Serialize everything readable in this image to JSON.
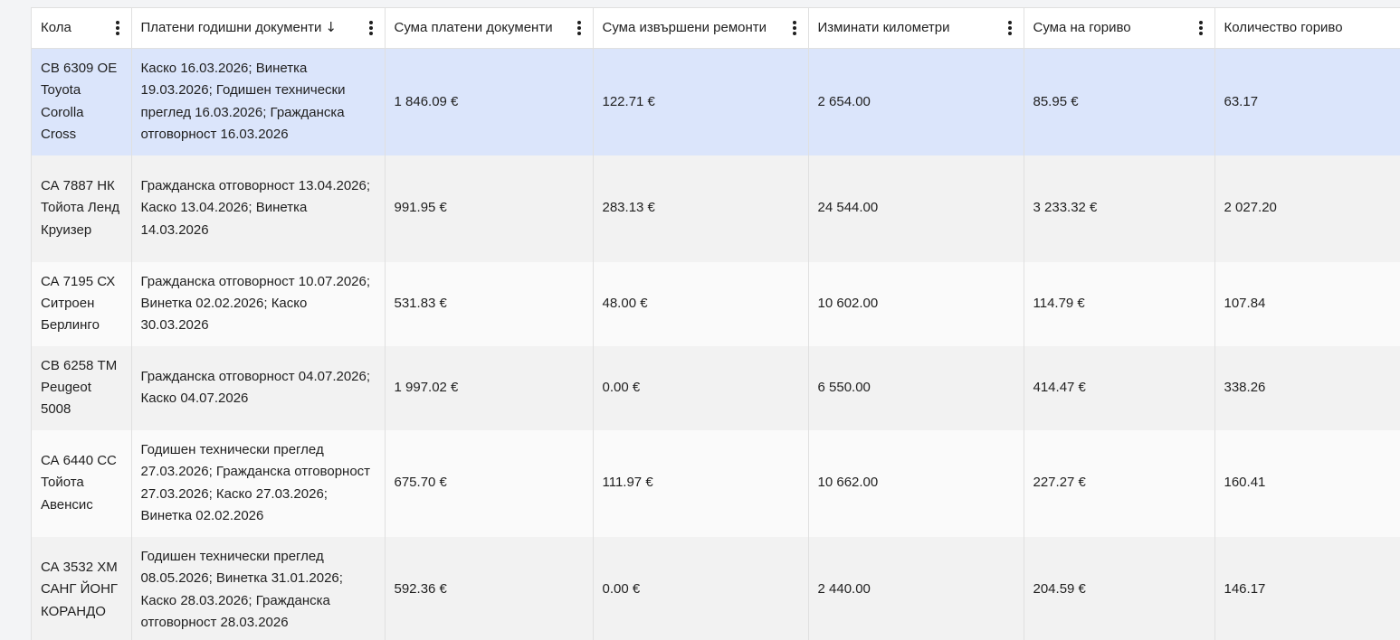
{
  "columns": [
    {
      "label": "Кола",
      "sort": "",
      "menu": true
    },
    {
      "label": "Платени годишни документи",
      "sort": "↓",
      "menu": true
    },
    {
      "label": "Сума платени документи",
      "sort": "",
      "menu": true
    },
    {
      "label": "Сума извършени ремонти",
      "sort": "",
      "menu": true
    },
    {
      "label": "Изминати километри",
      "sort": "",
      "menu": true
    },
    {
      "label": "Сума на гориво",
      "sort": "",
      "menu": true
    },
    {
      "label": "Количество гориво",
      "sort": "",
      "menu": false
    }
  ],
  "rows": [
    {
      "car": "СВ 6309 ОЕ Toyota Corolla Cross",
      "documents": "Каско 16.03.2026; Винетка 19.03.2026; Годишен технически преглед 16.03.2026; Гражданска отговорност 16.03.2026",
      "documents_sum": "1 846.09 €",
      "repairs_sum": "122.71 €",
      "kilometers": "2 654.00",
      "fuel_sum": "85.95 €",
      "fuel_qty": "63.17"
    },
    {
      "car": "СА 7887 НК Тойота Ленд Круизер",
      "documents": "Гражданска отговорност 13.04.2026; Каско 13.04.2026; Винетка 14.03.2026",
      "documents_sum": "991.95 €",
      "repairs_sum": "283.13 €",
      "kilometers": "24 544.00",
      "fuel_sum": "3 233.32 €",
      "fuel_qty": "2 027.20"
    },
    {
      "car": "СА 7195 СХ Ситроен Берлинго",
      "documents": "Гражданска отговорност 10.07.2026; Винетка 02.02.2026; Каско 30.03.2026",
      "documents_sum": "531.83 €",
      "repairs_sum": "48.00 €",
      "kilometers": "10 602.00",
      "fuel_sum": "114.79 €",
      "fuel_qty": "107.84"
    },
    {
      "car": "СВ 6258 ТМ Peugeot 5008",
      "documents": "Гражданска отговорност 04.07.2026; Каско 04.07.2026",
      "documents_sum": "1 997.02 €",
      "repairs_sum": "0.00 €",
      "kilometers": "6 550.00",
      "fuel_sum": "414.47 €",
      "fuel_qty": "338.26"
    },
    {
      "car": "СА 6440 СС Тойота Авенсис",
      "documents": "Годишен технически преглед 27.03.2026; Гражданска отговорност 27.03.2026; Каско 27.03.2026; Винетка 02.02.2026",
      "documents_sum": "675.70 €",
      "repairs_sum": "111.97 €",
      "kilometers": "10 662.00",
      "fuel_sum": "227.27 €",
      "fuel_qty": "160.41"
    },
    {
      "car": "СА 3532 ХМ САНГ ЙОНГ КОРАНДО",
      "documents": "Годишен технически преглед 08.05.2026; Винетка 31.01.2026; Каско 28.03.2026; Гражданска отговорност 28.03.2026",
      "documents_sum": "592.36 €",
      "repairs_sum": "0.00 €",
      "kilometers": "2 440.00",
      "fuel_sum": "204.59 €",
      "fuel_qty": "146.17"
    }
  ],
  "colors": {
    "selected_row": "#dbe5fb",
    "even_row": "#f2f2f2",
    "odd_row": "#fafafa",
    "border": "#e0e0e0"
  }
}
